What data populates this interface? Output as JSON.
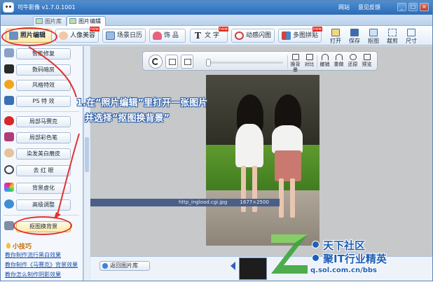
{
  "window": {
    "title": "可牛影像 v1.7.0.1001",
    "links": [
      "网站",
      "意见反馈"
    ],
    "buttons": [
      "_",
      "□",
      "×"
    ]
  },
  "tabs": [
    {
      "label": "图片库",
      "active": false
    },
    {
      "label": "图片编辑",
      "active": true
    }
  ],
  "toolbar": {
    "modules": [
      {
        "label": "照片编辑",
        "icon": "photo-edit-icon",
        "selected": true,
        "hot": ""
      },
      {
        "label": "人像美容",
        "icon": "portrait-icon",
        "selected": false,
        "hot": "new"
      },
      {
        "label": "场景日历",
        "icon": "calendar-icon",
        "selected": false,
        "hot": ""
      },
      {
        "label": "饰 品",
        "icon": "bow-icon",
        "selected": false,
        "hot": ""
      },
      {
        "label": "文 字",
        "icon": "text-icon",
        "selected": false,
        "hot": "new"
      },
      {
        "label": "动感闪图",
        "icon": "flash-icon",
        "selected": false,
        "hot": ""
      },
      {
        "label": "多图拼贴",
        "icon": "collage-icon",
        "selected": false,
        "hot": "new"
      }
    ],
    "actions": [
      {
        "label": "打开",
        "icon": "open-icon"
      },
      {
        "label": "保存",
        "icon": "save-icon"
      },
      {
        "label": "抠图",
        "icon": "cutout-icon"
      },
      {
        "label": "裁剪",
        "icon": "crop-icon"
      },
      {
        "label": "尺寸",
        "icon": "resize-icon"
      }
    ]
  },
  "sidebar": {
    "items": [
      {
        "label": "智能修复",
        "icon": "smart-fix-icon",
        "color": "#8aa1c4"
      },
      {
        "label": "数码暗房",
        "icon": "camera-icon",
        "color": "#2a2a2a"
      },
      {
        "label": "风格特效",
        "icon": "sun-icon",
        "color": "#f2a51c"
      },
      {
        "label": "PS 特 效",
        "icon": "ps-icon",
        "color": "#3a6fb5"
      },
      {
        "label": "局部马赛克",
        "icon": "mosaic-icon",
        "color": "#d8262a"
      },
      {
        "label": "局部彩色笔",
        "icon": "color-pen-icon",
        "color": "#b23a7a"
      },
      {
        "label": "染发美白磨皮",
        "icon": "face-icon",
        "color": "#e7c29a"
      },
      {
        "label": "去 红 眼",
        "icon": "eye-icon",
        "color": "#444"
      },
      {
        "label": "背景虚化",
        "icon": "blur-icon",
        "color": "#c3456f"
      },
      {
        "label": "高级调整",
        "icon": "gear-icon",
        "color": "#3f8ed6"
      },
      {
        "label": "抠图换背景",
        "icon": "cutout-bg-icon",
        "color": "#7c8ea8"
      }
    ],
    "tips_title": "小技巧",
    "tips": [
      "教你制作流行黑白效果",
      "教你制作《马赛克》背景效果",
      "教你怎么制作阴影效果"
    ]
  },
  "viewer": {
    "buttons": [
      {
        "label": "换背景",
        "icon": "swap-bg-icon"
      },
      {
        "label": "对比",
        "icon": "compare-icon"
      },
      {
        "label": "撤销",
        "icon": "undo-icon"
      },
      {
        "label": "重做",
        "icon": "redo-icon"
      },
      {
        "label": "还原",
        "icon": "restore-icon"
      },
      {
        "label": "预览",
        "icon": "preview-icon"
      }
    ],
    "caption": "http_ingload.cgi.jpg",
    "caption_size": "1677×2500"
  },
  "bottom": {
    "back_label": "返回图片库"
  },
  "annotation": {
    "line1": "1.在“照片编辑”里打开一张图片",
    "line2": "并选择“抠图换背景”"
  },
  "watermark": {
    "line1": "天下社区",
    "line2": "聚IT行业精英",
    "url": "q.sol.com.cn/bbs"
  }
}
